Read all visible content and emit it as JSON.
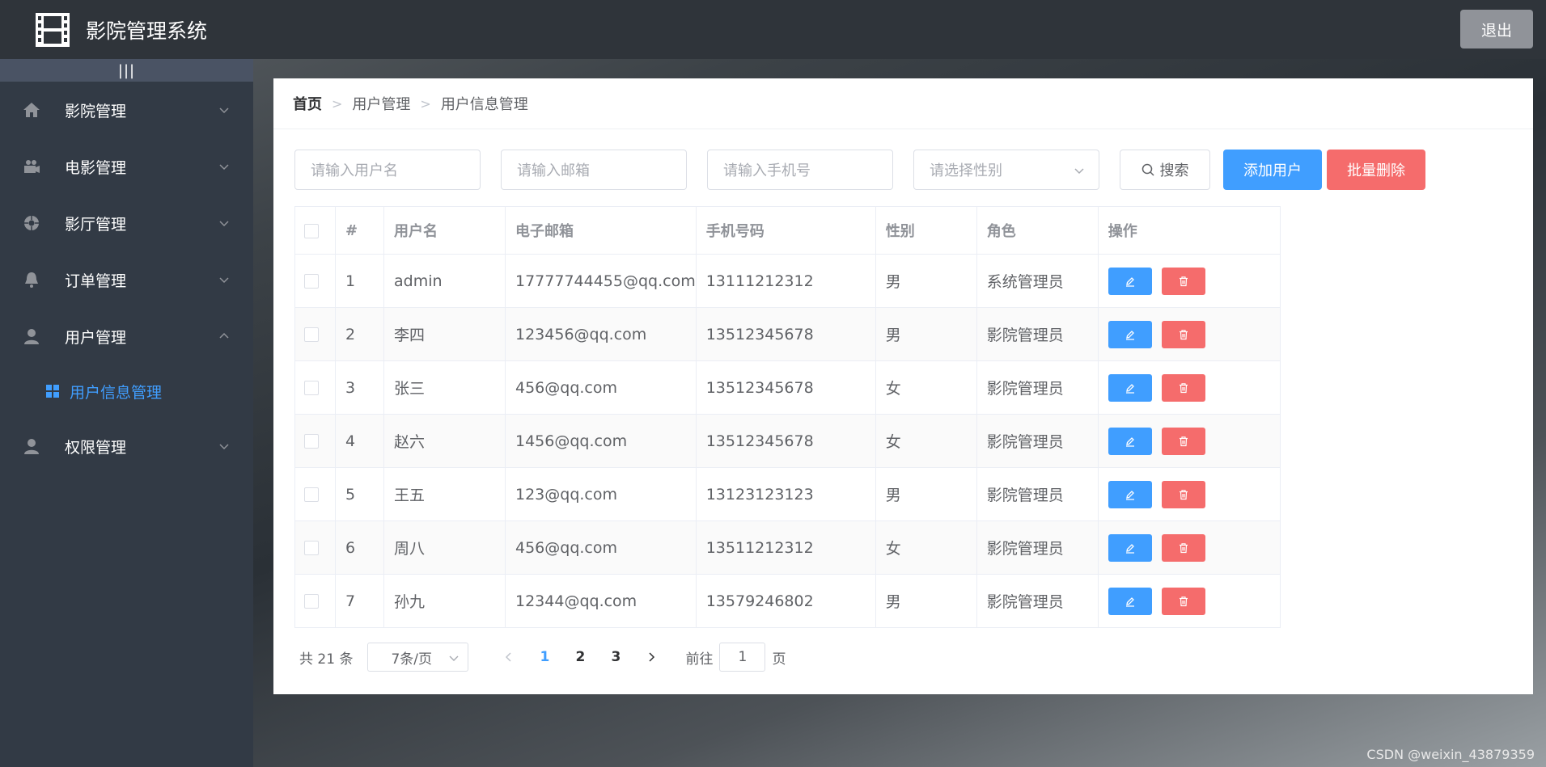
{
  "header": {
    "title": "影院管理系统",
    "logout_label": "退出"
  },
  "sidebar": {
    "collapse_label": "|||",
    "items": [
      {
        "label": "影院管理",
        "icon": "home-icon",
        "expanded": false
      },
      {
        "label": "电影管理",
        "icon": "camera-icon",
        "expanded": false
      },
      {
        "label": "影厅管理",
        "icon": "aperture-icon",
        "expanded": false
      },
      {
        "label": "订单管理",
        "icon": "bell-icon",
        "expanded": false
      },
      {
        "label": "用户管理",
        "icon": "user-icon",
        "expanded": true,
        "children": [
          {
            "label": "用户信息管理",
            "icon": "grid-icon",
            "active": true
          }
        ]
      },
      {
        "label": "权限管理",
        "icon": "user-icon",
        "expanded": false
      }
    ]
  },
  "breadcrumb": [
    "首页",
    "用户管理",
    "用户信息管理"
  ],
  "filters": {
    "username_placeholder": "请输入用户名",
    "email_placeholder": "请输入邮箱",
    "phone_placeholder": "请输入手机号",
    "gender_placeholder": "请选择性别",
    "search_label": "搜索",
    "add_label": "添加用户",
    "batch_delete_label": "批量删除"
  },
  "table": {
    "columns": [
      "#",
      "用户名",
      "电子邮箱",
      "手机号码",
      "性别",
      "角色",
      "操作"
    ],
    "rows": [
      {
        "id": "1",
        "username": "admin",
        "email": "17777744455@qq.com",
        "phone": "13111212312",
        "gender": "男",
        "role": "系统管理员"
      },
      {
        "id": "2",
        "username": "李四",
        "email": "123456@qq.com",
        "phone": "13512345678",
        "gender": "男",
        "role": "影院管理员"
      },
      {
        "id": "3",
        "username": "张三",
        "email": "456@qq.com",
        "phone": "13512345678",
        "gender": "女",
        "role": "影院管理员"
      },
      {
        "id": "4",
        "username": "赵六",
        "email": "1456@qq.com",
        "phone": "13512345678",
        "gender": "女",
        "role": "影院管理员"
      },
      {
        "id": "5",
        "username": "王五",
        "email": "123@qq.com",
        "phone": "13123123123",
        "gender": "男",
        "role": "影院管理员"
      },
      {
        "id": "6",
        "username": "周八",
        "email": "456@qq.com",
        "phone": "13511212312",
        "gender": "女",
        "role": "影院管理员"
      },
      {
        "id": "7",
        "username": "孙九",
        "email": "12344@qq.com",
        "phone": "13579246802",
        "gender": "男",
        "role": "影院管理员"
      }
    ]
  },
  "pagination": {
    "total_label": "共 21 条",
    "page_size_label": "7条/页",
    "pages": [
      "1",
      "2",
      "3"
    ],
    "current_page": "1",
    "goto_prefix": "前往",
    "goto_value": "1",
    "goto_suffix": "页"
  },
  "watermark": "CSDN @weixin_43879359",
  "colors": {
    "primary": "#409eff",
    "danger": "#f56c6c",
    "sidebar_bg": "#323a45",
    "header_bg": "#2f343a"
  }
}
